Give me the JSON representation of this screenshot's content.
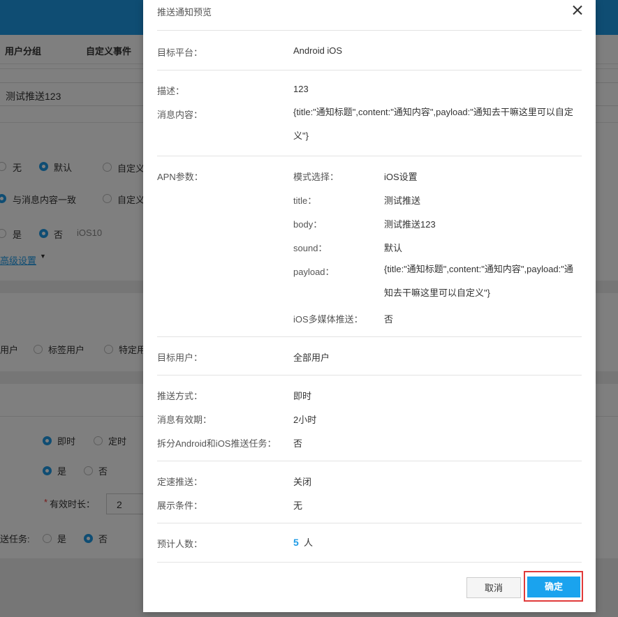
{
  "background": {
    "tabs": [
      "用户分组",
      "自定义事件"
    ],
    "push_name": "测试推送123",
    "row1": {
      "none": "无",
      "default": "默认",
      "custom": "自定义"
    },
    "row2": {
      "same": "与消息内容一致",
      "custom": "自定义"
    },
    "row3": {
      "yes": "是",
      "no": "否",
      "note": "iOS10"
    },
    "advanced": "高级设置",
    "target": {
      "all": "用户",
      "tag": "标签用户",
      "specific": "特定用"
    },
    "send": {
      "now": "即时",
      "timed": "定时"
    },
    "offline": {
      "yes": "是",
      "no": "否"
    },
    "validity_label": "有效时长：",
    "required_mark": "*",
    "validity_value": "2",
    "split": {
      "label": "送任务:",
      "yes": "是",
      "no": "否"
    }
  },
  "modal": {
    "title": "推送通知预览",
    "platform": {
      "label": "目标平台：",
      "value": "Android iOS"
    },
    "description": {
      "label": "描述：",
      "value": "123"
    },
    "content": {
      "label": "消息内容：",
      "value": "{title:\"通知标题\",content:\"通知内容\",payload:\"通知去干嘛这里可以自定义\"}"
    },
    "apn": {
      "label": "APN参数：",
      "mode": {
        "label": "模式选择：",
        "value": "iOS设置"
      },
      "title": {
        "label": "title：",
        "value": "测试推送"
      },
      "body": {
        "label": "body：",
        "value": "测试推送123"
      },
      "sound": {
        "label": "sound：",
        "value": "默认"
      },
      "payload": {
        "label": "payload：",
        "value": "{title:\"通知标题\",content:\"通知内容\",payload:\"通知去干嘛这里可以自定义\"}"
      },
      "media": {
        "label": "iOS多媒体推送：",
        "value": "否"
      }
    },
    "target_users": {
      "label": "目标用户：",
      "value": "全部用户"
    },
    "push_method": {
      "label": "推送方式：",
      "value": "即时"
    },
    "validity": {
      "label": "消息有效期：",
      "value": "2小时"
    },
    "split": {
      "label": "拆分Android和iOS推送任务：",
      "value": "否"
    },
    "rate": {
      "label": "定速推送：",
      "value": "关闭"
    },
    "display": {
      "label": "展示条件：",
      "value": "无"
    },
    "estimate": {
      "label": "预计人数：",
      "count": "5",
      "unit": "人"
    },
    "cancel": "取消",
    "confirm": "确定"
  }
}
